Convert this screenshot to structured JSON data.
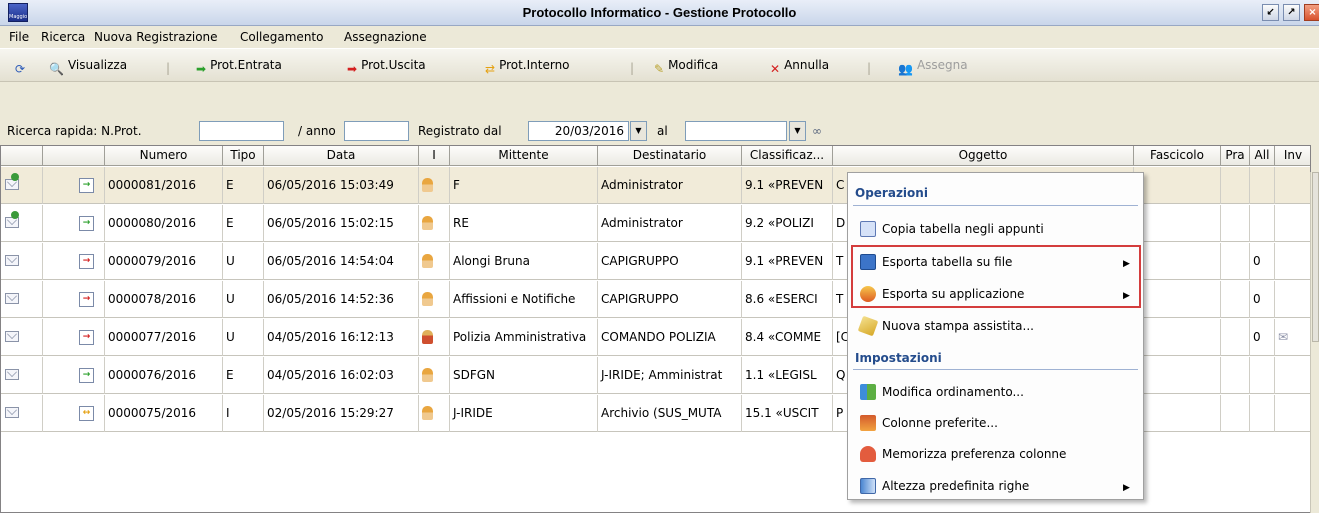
{
  "window": {
    "title": "Protocollo Informatico - Gestione Protocollo",
    "app_logo_text": "Maggioli"
  },
  "menu": [
    "File",
    "Ricerca",
    "Nuova Registrazione",
    "Collegamento",
    "Assegnazione"
  ],
  "toolbar": [
    {
      "label": "Visualizza",
      "icon": "magnifier-icon",
      "enabled": true
    },
    {
      "label": "Prot.Entrata",
      "icon": "green-arrow-icon",
      "enabled": true
    },
    {
      "label": "Prot.Uscita",
      "icon": "red-arrow-icon",
      "enabled": true
    },
    {
      "label": "Prot.Interno",
      "icon": "orange-arrows-icon",
      "enabled": true
    },
    {
      "label": "Modifica",
      "icon": "pencil-icon",
      "enabled": true
    },
    {
      "label": "Annulla",
      "icon": "red-x-icon",
      "enabled": true
    },
    {
      "label": "Assegna",
      "icon": "people-icon",
      "enabled": false
    }
  ],
  "search": {
    "quick_label": "Ricerca rapida: N.Prot.",
    "year_label": "/ anno",
    "registered_from_label": "Registrato dal",
    "registered_from_value": "20/03/2016",
    "to_label": "al",
    "prot_value": "",
    "year_value": "",
    "to_value": ""
  },
  "columns": [
    "",
    "",
    "Numero",
    "Tipo",
    "Data",
    "I",
    "Mittente",
    "Destinatario",
    "Classificaz...",
    "Oggetto",
    "Fascicolo",
    "Pra",
    "All",
    "Inv"
  ],
  "rows": [
    {
      "numero": "0000081/2016",
      "tipo": "E",
      "data": "06/05/2016 15:03:49",
      "mittente": "F",
      "destinatario": "Administrator",
      "classificazione": "9.1 «PREVEN",
      "oggetto": "C",
      "all": "",
      "inv": ""
    },
    {
      "numero": "0000080/2016",
      "tipo": "E",
      "data": "06/05/2016 15:02:15",
      "mittente": "RE",
      "destinatario": "Administrator",
      "classificazione": "9.2 «POLIZI",
      "oggetto": "D",
      "all": "",
      "inv": ""
    },
    {
      "numero": "0000079/2016",
      "tipo": "U",
      "data": "06/05/2016 14:54:04",
      "mittente": "Alongi Bruna",
      "destinatario": "CAPIGRUPPO",
      "classificazione": "9.1 «PREVEN",
      "oggetto": "T",
      "all": "0",
      "inv": ""
    },
    {
      "numero": "0000078/2016",
      "tipo": "U",
      "data": "06/05/2016 14:52:36",
      "mittente": "Affissioni e Notifiche",
      "destinatario": "CAPIGRUPPO",
      "classificazione": "8.6 «ESERCI",
      "oggetto": "T",
      "all": "0",
      "inv": ""
    },
    {
      "numero": "0000077/2016",
      "tipo": "U",
      "data": "04/05/2016 16:12:13",
      "mittente": "Polizia Amministrativa",
      "destinatario": "COMANDO POLIZIA",
      "classificazione": "8.4 «COMME",
      "oggetto": "[C",
      "all": "0",
      "inv": "✉"
    },
    {
      "numero": "0000076/2016",
      "tipo": "E",
      "data": "04/05/2016 16:02:03",
      "mittente": "SDFGN",
      "destinatario": "J-IRIDE; Amministrat",
      "classificazione": "1.1 «LEGISL",
      "oggetto": "Q",
      "all": "",
      "inv": ""
    },
    {
      "numero": "0000075/2016",
      "tipo": "I",
      "data": "02/05/2016 15:29:27",
      "mittente": "J-IRIDE",
      "destinatario": "Archivio (SUS_MUTA",
      "classificazione": "15.1 «USCIT",
      "oggetto": "P",
      "all": "",
      "inv": ""
    }
  ],
  "context_menu": {
    "section_operations": "Operazioni",
    "copy_table": "Copia tabella negli appunti",
    "export_table_file": "Esporta tabella su file",
    "export_application": "Esporta su applicazione",
    "new_print": "Nuova stampa assistita...",
    "section_settings": "Impostazioni",
    "edit_order": "Modifica ordinamento...",
    "preferred_columns": "Colonne preferite...",
    "save_columns": "Memorizza preferenza colonne",
    "row_height": "Altezza predefinita righe"
  },
  "colors": {
    "highlight": "#d43d3d",
    "selected_row": "#f1ebd9",
    "menu_heading": "#244c8c"
  }
}
